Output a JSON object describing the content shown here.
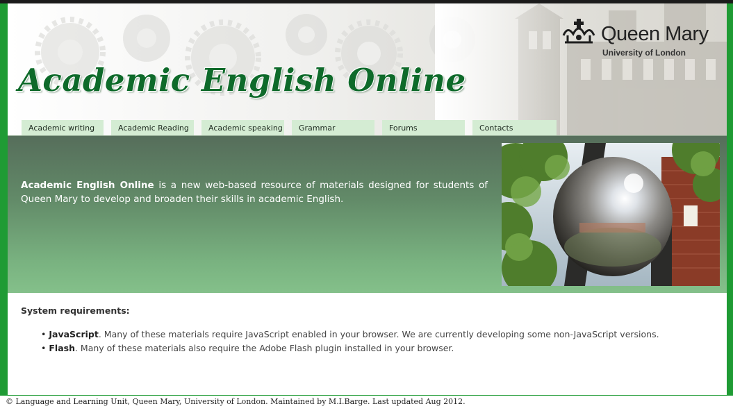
{
  "header": {
    "site_title": "Academic English Online",
    "logo": {
      "name": "Queen Mary",
      "subtitle": "University of London",
      "icon": "crown-icon"
    }
  },
  "nav": {
    "tabs": [
      {
        "label": "Academic writing"
      },
      {
        "label": "Academic Reading"
      },
      {
        "label": "Academic speaking"
      },
      {
        "label": "Grammar"
      },
      {
        "label": "Forums"
      },
      {
        "label": "Contacts"
      }
    ]
  },
  "banner": {
    "intro_bold": "Academic English Online",
    "intro_rest": " is a new web-based resource of materials designed for students of Queen Mary to develop and broaden their skills in academic English.",
    "photo_icon": "reflective-sphere-sculpture-photo"
  },
  "requirements": {
    "title": "System requirements:",
    "items": [
      {
        "term": "JavaScript",
        "text": ". Many of these materials require JavaScript enabled in your browser. We are currently developing some non-JavaScript versions."
      },
      {
        "term": "Flash",
        "text": ". Many of these materials also require the Adobe Flash plugin installed in your browser."
      }
    ]
  },
  "footer": {
    "text": "© Language and Learning Unit, Queen Mary, University of London. Maintained by M.I.Barge. Last updated Aug 2012."
  },
  "colors": {
    "frame_green": "#1f9b34",
    "title_green": "#0e6a2a",
    "nav_tab": "#d4ecd3",
    "banner_top": "#566e5b",
    "banner_bottom": "#84c08a"
  }
}
